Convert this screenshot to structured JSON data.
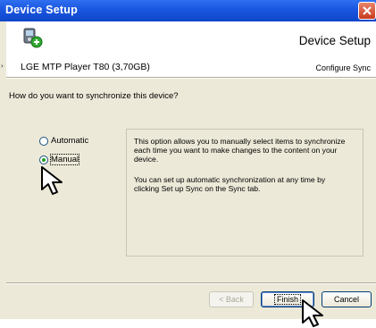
{
  "window": {
    "title": "Device Setup"
  },
  "header": {
    "heading": "Device Setup",
    "device_name": "LGE MTP Player T80 (3,70GB)",
    "configure_label": "Configure Sync",
    "icon": "device-sync-icon"
  },
  "question": "How do you want to synchronize this device?",
  "options": [
    {
      "label": "Automatic",
      "selected": false
    },
    {
      "label": "Manual",
      "selected": true
    }
  ],
  "description": {
    "paragraph1": "This option allows you to manually select items to synchronize each time you want to make changes to the content on your device.",
    "paragraph2": "You can set up automatic synchronization at any time by clicking Set up Sync on the Sync tab."
  },
  "buttons": {
    "back": "< Back",
    "finish": "Finish",
    "cancel": "Cancel"
  },
  "colors": {
    "title_bar": "#1a56e0",
    "dialog_bg": "#ece9d8",
    "radio_selected": "#21a121",
    "close_button": "#c9391c"
  }
}
